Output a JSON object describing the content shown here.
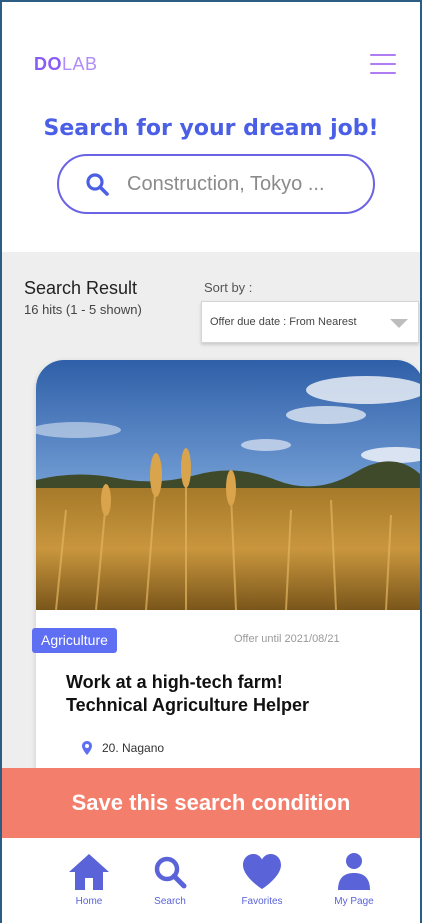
{
  "header": {
    "logo_part1": "DO",
    "logo_part2": "LAB",
    "headline": "Search for your dream job!",
    "search_placeholder": "Construction, Tokyo ..."
  },
  "results": {
    "title": "Search Result",
    "hits": "16  hits (1 - 5 shown)",
    "sort_label": "Sort by :",
    "sort_value": "Offer due date : From Nearest"
  },
  "card": {
    "image": "wheat-field-photo",
    "category": "Agriculture",
    "offer_until": "Offer until 2021/08/21",
    "title_line1": "Work at a high-tech farm!",
    "title_line2": "Technical Agriculture Helper",
    "location": "20. Nagano"
  },
  "save_button": "Save this search condition",
  "nav": {
    "items": [
      {
        "label": "Home",
        "icon": "home-icon"
      },
      {
        "label": "Search",
        "icon": "search-icon"
      },
      {
        "label": "Favorites",
        "icon": "heart-icon"
      },
      {
        "label": "My Page",
        "icon": "user-icon"
      }
    ]
  },
  "colors": {
    "primary": "#5f6ff3",
    "headline": "#4a5fe6",
    "accent_purple": "#8a5cf6",
    "save_bar": "#f47e6c",
    "band": "#eeeeee"
  }
}
